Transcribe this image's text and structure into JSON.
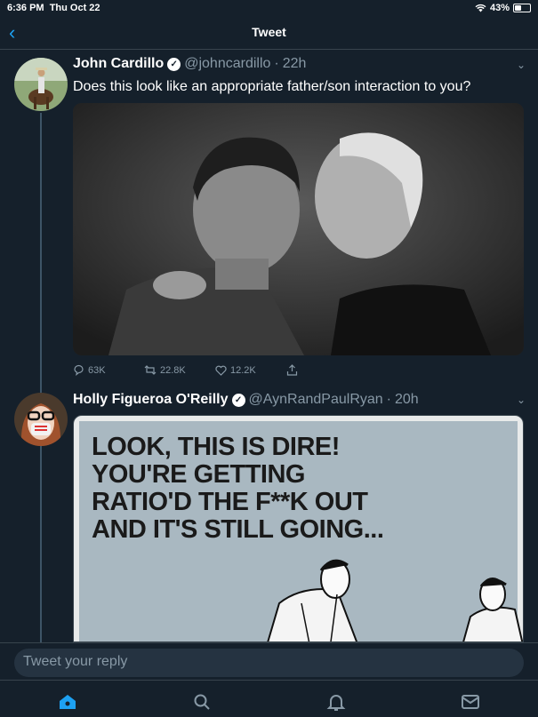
{
  "status_bar": {
    "time": "6:36 PM",
    "date": "Thu Oct 22",
    "battery": "43%",
    "battery_level": 0.43
  },
  "nav": {
    "title": "Tweet"
  },
  "tweet": {
    "name": "John Cardillo",
    "handle": "@johncardillo",
    "time": "22h",
    "text": "Does this look like an appropriate father/son interaction to you?",
    "replies": "63K",
    "retweets": "22.8K",
    "likes": "12.2K"
  },
  "reply_tweet": {
    "name": "Holly Figueroa O'Reilly",
    "handle": "@AynRandPaulRyan",
    "time": "20h",
    "meme_lines": [
      "LOOK, THIS IS DIRE!",
      "YOU'RE GETTING",
      "RATIO'D THE F**K OUT",
      "AND IT'S STILL GOING..."
    ]
  },
  "reply_box": {
    "placeholder": "Tweet your reply"
  },
  "colors": {
    "background": "#15202b",
    "accent": "#1da1f2",
    "muted": "#8899a6"
  },
  "tabs": [
    "home-icon",
    "search-icon",
    "notifications-icon",
    "messages-icon"
  ]
}
